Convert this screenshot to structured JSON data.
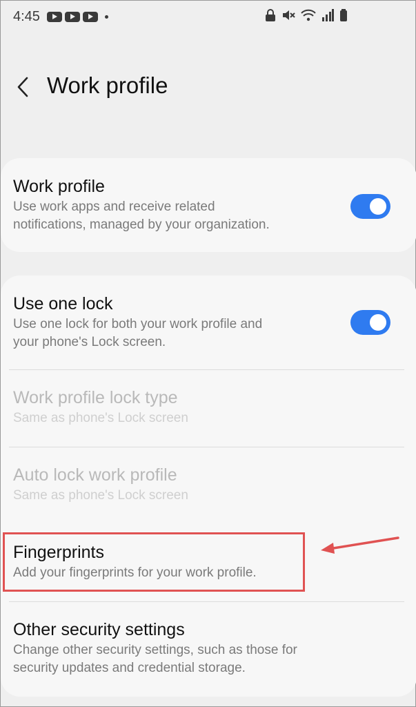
{
  "status_bar": {
    "time": "4:45",
    "left_icons": [
      "youtube-icon",
      "youtube-icon",
      "youtube-icon",
      "notification-dot"
    ],
    "right_icons": [
      "lock-icon",
      "mute-icon",
      "wifi-icon",
      "signal-icon",
      "battery-icon"
    ]
  },
  "header": {
    "back_icon": "back-chevron-icon",
    "title": "Work profile"
  },
  "work_profile": {
    "title": "Work profile",
    "subtitle_line1": "Use work apps and receive related",
    "subtitle_line2": "notifications, managed by your organization.",
    "toggle_on": true
  },
  "security": {
    "use_one_lock": {
      "title": "Use one lock",
      "subtitle_line1": "Use one lock for both your work profile and",
      "subtitle_line2": "your phone's Lock screen.",
      "toggle_on": true
    },
    "lock_type": {
      "title": "Work profile lock type",
      "subtitle": "Same as phone's Lock screen",
      "enabled": false
    },
    "auto_lock": {
      "title": "Auto lock work profile",
      "subtitle": "Same as phone's Lock screen",
      "enabled": false
    },
    "fingerprints": {
      "title": "Fingerprints",
      "subtitle": "Add your fingerprints for your work profile."
    },
    "other": {
      "title": "Other security settings",
      "subtitle_line1": "Change other security settings, such as those for",
      "subtitle_line2": "security updates and credential storage."
    }
  },
  "colors": {
    "toggle_on": "#2f7bf0",
    "annotation": "#e05252",
    "background": "#efefef",
    "card": "#f7f7f7"
  }
}
